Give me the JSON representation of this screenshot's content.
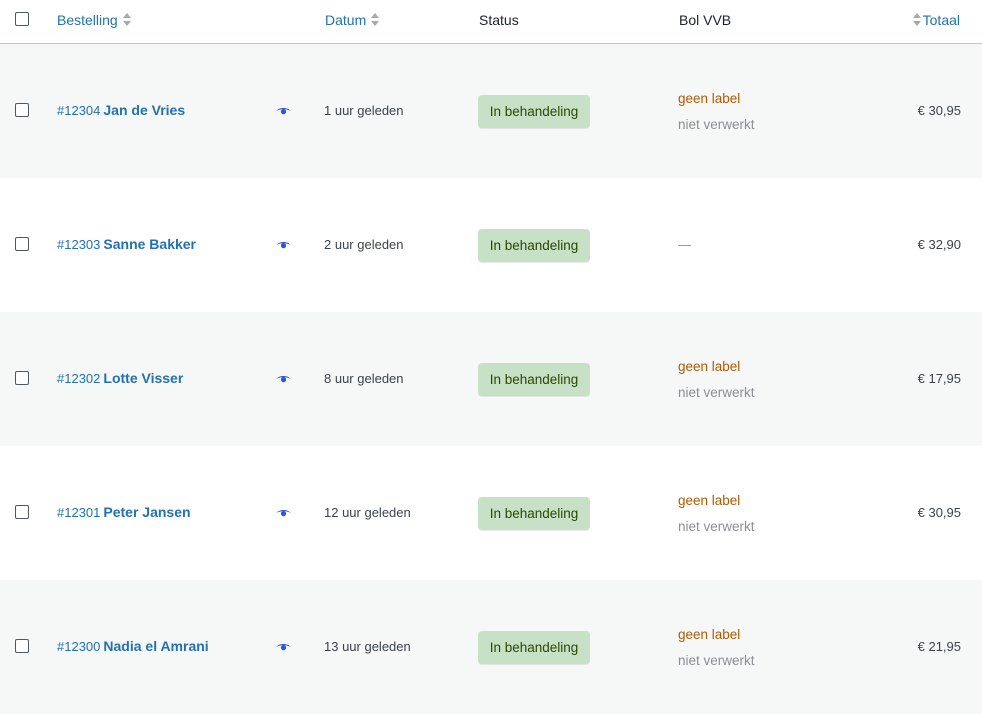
{
  "header": {
    "bestelling": "Bestelling",
    "datum": "Datum",
    "status": "Status",
    "bol": "Bol VVB",
    "totaal": "Totaal"
  },
  "rows": [
    {
      "number": "#12304",
      "name": "Jan de Vries",
      "date": "1 uur geleden",
      "status": "In behandeling",
      "bol_label": "geen label",
      "bol_state": "niet verwerkt",
      "total": "€ 30,95"
    },
    {
      "number": "#12303",
      "name": "Sanne Bakker",
      "date": "2 uur geleden",
      "status": "In behandeling",
      "bol_dash": "—",
      "total": "€ 32,90"
    },
    {
      "number": "#12302",
      "name": "Lotte Visser",
      "date": "8 uur geleden",
      "status": "In behandeling",
      "bol_label": "geen label",
      "bol_state": "niet verwerkt",
      "total": "€ 17,95"
    },
    {
      "number": "#12301",
      "name": "Peter Jansen",
      "date": "12 uur geleden",
      "status": "In behandeling",
      "bol_label": "geen label",
      "bol_state": "niet verwerkt",
      "total": "€ 30,95"
    },
    {
      "number": "#12300",
      "name": "Nadia el Amrani",
      "date": "13 uur geleden",
      "status": "In behandeling",
      "bol_label": "geen label",
      "bol_state": "niet verwerkt",
      "total": "€ 21,95"
    }
  ],
  "icons": {
    "preview": "eye-icon",
    "sort": "sort-arrows-icon"
  },
  "colors": {
    "link": "#2271b1",
    "status_bg": "#c6e1c6",
    "status_text": "#2c4700",
    "bol_label": "#b35900",
    "muted": "#8c8f94",
    "row_alt": "#f6f7f7"
  }
}
